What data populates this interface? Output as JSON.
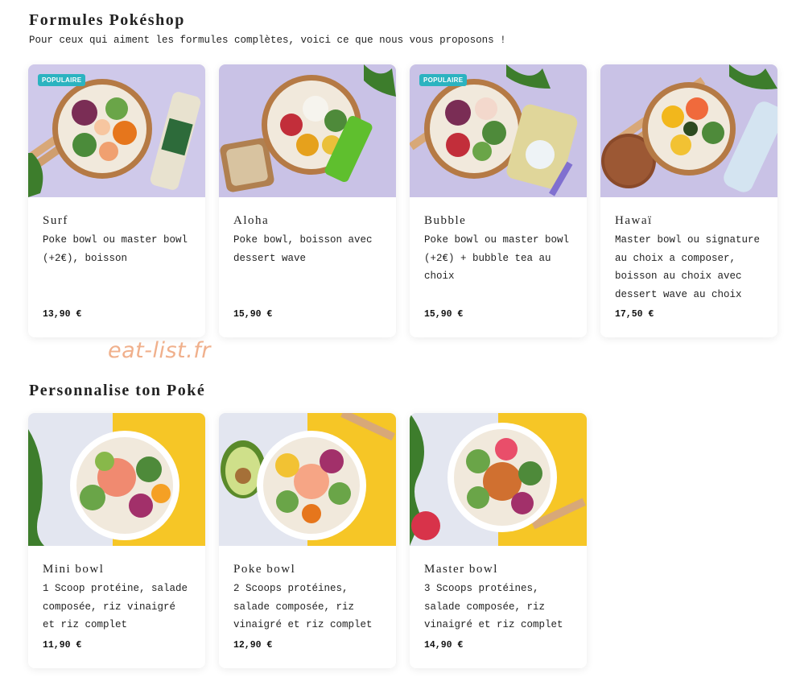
{
  "formules": {
    "title": "Formules Pokéshop",
    "subtitle": "Pour ceux qui aiment les formules complètes, voici ce que nous vous proposons !",
    "items": [
      {
        "name": "Surf",
        "description": "Poke bowl ou master bowl (+2€), boisson",
        "price": "13,90 €",
        "badge": "POPULAIRE"
      },
      {
        "name": "Aloha",
        "description": "Poke bowl, boisson avec dessert wave",
        "price": "15,90 €",
        "badge": ""
      },
      {
        "name": "Bubble",
        "description": "Poke bowl ou master bowl (+2€) + bubble tea au choix",
        "price": "15,90 €",
        "badge": "POPULAIRE"
      },
      {
        "name": "Hawaï",
        "description": "Master bowl ou signature au choix a composer, boisson au choix avec dessert wave au choix",
        "price": "17,50 €",
        "badge": ""
      }
    ]
  },
  "watermark": "eat-list.fr",
  "personnalise": {
    "title": "Personnalise ton Poké",
    "items": [
      {
        "name": "Mini bowl",
        "description": "1 Scoop protéine, salade composée, riz vinaigré et riz complet",
        "price": "11,90 €"
      },
      {
        "name": "Poke bowl",
        "description": "2 Scoops protéines, salade composée, riz vinaigré et riz complet",
        "price": "12,90 €"
      },
      {
        "name": "Master bowl",
        "description": "3 Scoops protéines, salade composée, riz vinaigré et riz complet",
        "price": "14,90 €"
      }
    ]
  },
  "colors": {
    "badge": "#2bb3c0",
    "lavender_background": "#c9c2e6",
    "yellow_background": "#f6c626",
    "watermark": "#f0b08c"
  }
}
